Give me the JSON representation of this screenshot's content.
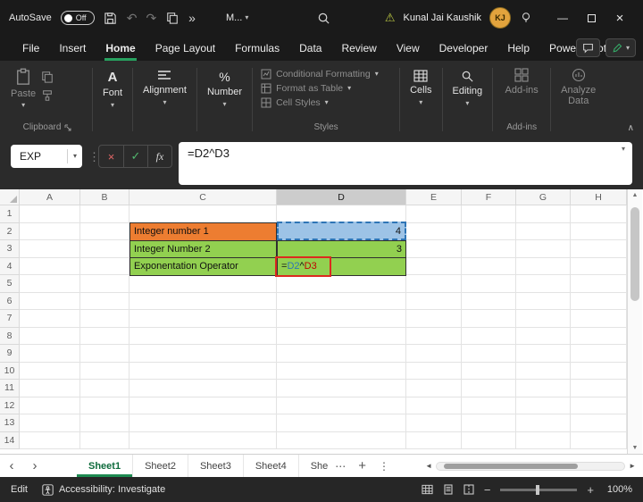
{
  "colors": {
    "accent_green": "#27a15f",
    "cell_orange": "#ed7d31",
    "cell_blue": "#9dc3e6",
    "cell_green": "#92d050",
    "ref_blue": "#2e75b6",
    "ref_red": "#c00000",
    "annotation_red": "#dc2a1e"
  },
  "icons": {
    "undo": "↶",
    "redo": "↷",
    "overflow": "»",
    "caret": "▾",
    "dots_v": "⋮",
    "more": "⋯",
    "cancel": "×",
    "enter": "✓",
    "minimize": "—",
    "close": "×",
    "nav_left": "‹",
    "nav_right": "›",
    "up": "▲",
    "down": "▼",
    "left": "◄",
    "right": "►",
    "plus": "+",
    "minus": "−",
    "collapse": "∧",
    "warning": "⚠"
  },
  "titlebar": {
    "autosave_label": "AutoSave",
    "autosave_state": "Off",
    "doc_menu": "M...",
    "user_name": "Kunal Jai Kaushik",
    "user_initials": "KJ"
  },
  "menubar": {
    "tabs": [
      "File",
      "Insert",
      "Home",
      "Page Layout",
      "Formulas",
      "Data",
      "Review",
      "View",
      "Developer",
      "Help",
      "Power Pivot"
    ],
    "active_tab": "Home"
  },
  "ribbon": {
    "paste": "Paste",
    "clipboard_group": "Clipboard",
    "font": "Font",
    "font_glyph": "A",
    "alignment": "Alignment",
    "number": "Number",
    "number_glyph": "%",
    "conditional_formatting": "Conditional Formatting",
    "format_as_table": "Format as Table",
    "cell_styles": "Cell Styles",
    "styles_group": "Styles",
    "cells": "Cells",
    "editing": "Editing",
    "addins": "Add-ins",
    "addins_group": "Add-ins",
    "analyze_line1": "Analyze",
    "analyze_line2": "Data"
  },
  "formula_bar": {
    "name_box": "EXP",
    "fx": "fx",
    "formula": "=D2^D3"
  },
  "grid": {
    "columns": [
      "A",
      "B",
      "C",
      "D",
      "E",
      "F",
      "G",
      "H"
    ],
    "selected_column": "D",
    "rows": [
      "1",
      "2",
      "3",
      "4",
      "5",
      "6",
      "7",
      "8",
      "9",
      "10",
      "11",
      "12",
      "13",
      "14"
    ],
    "cells": {
      "c2": "Integer number 1",
      "d2": "4",
      "c3": "Integer Number 2",
      "d3": "3",
      "c4": "Exponentation Operator",
      "d4": {
        "eq": "=",
        "ref1": "D2",
        "op": "^",
        "ref2": "D3"
      }
    }
  },
  "sheet_tabs": {
    "tabs": [
      "Sheet1",
      "Sheet2",
      "Sheet3",
      "Sheet4",
      "She"
    ],
    "active": "Sheet1"
  },
  "status_bar": {
    "mode": "Edit",
    "accessibility": "Accessibility: Investigate",
    "zoom": "100%"
  }
}
